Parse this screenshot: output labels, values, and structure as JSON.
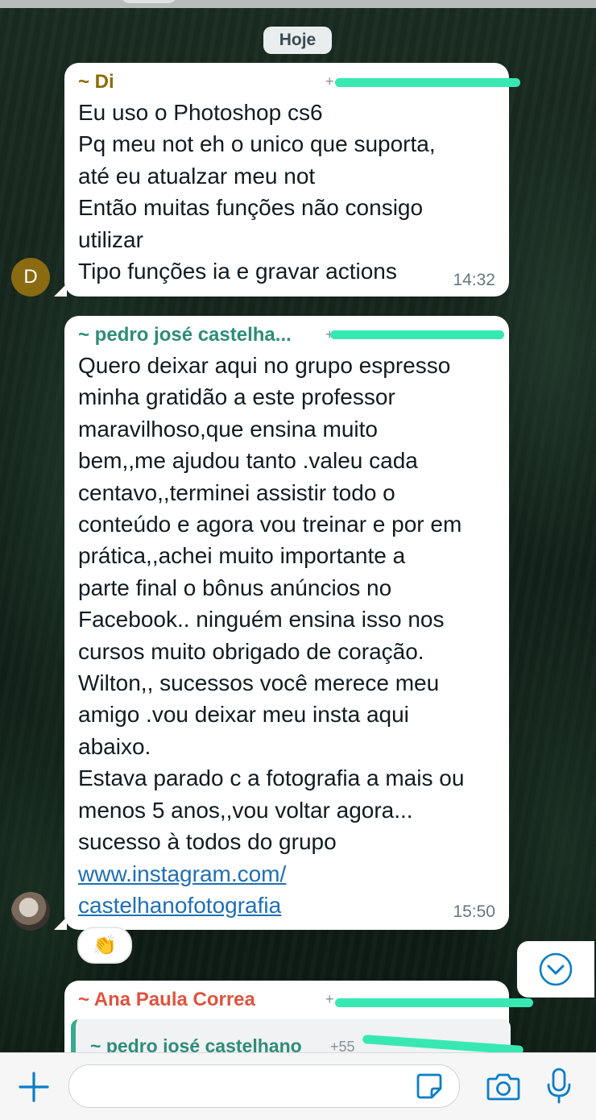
{
  "date_divider": "Hoje",
  "messages": [
    {
      "sender": "~ Di",
      "sender_color": "#8f6a0a",
      "phone": "+",
      "avatar_initial": "D",
      "lines": [
        "Eu uso o Photoshop cs6",
        "Pq meu not eh o unico que suporta,",
        "até eu atualzar meu not",
        "Então muitas funções não consigo",
        "utilizar",
        "Tipo funções ia e gravar actions"
      ],
      "time": "14:32"
    },
    {
      "sender": "~ pedro josé castelha...",
      "sender_color": "#2e8c7a",
      "phone": "+",
      "lines": [
        "Quero deixar aqui no grupo espresso",
        "minha gratidão a este professor",
        "maravilhoso,que ensina muito",
        "bem,,me ajudou tanto .valeu cada",
        "centavo,,terminei assistir todo o",
        "conteúdo e agora vou treinar e por em",
        "prática,,achei muito importante a",
        "parte final o bônus anúncios no",
        "Facebook.. ninguém ensina isso nos",
        "cursos muito obrigado de coração.",
        "Wilton,, sucessos você merece meu",
        "amigo .vou deixar meu insta aqui",
        "abaixo.",
        "Estava parado c a fotografia a mais ou",
        "menos 5 anos,,vou voltar agora...",
        "sucesso à todos do grupo"
      ],
      "link_lines": [
        "www.instagram.com/",
        "castelhanofotografia"
      ],
      "time": "15:50",
      "reaction": "👏"
    },
    {
      "sender": "~ Ana Paula Correa",
      "sender_color": "#e0533f",
      "phone": "+",
      "quoted_sender": "~ pedro josé castelhano",
      "quoted_phone": "+55"
    }
  ],
  "icons": {
    "scroll_down": "chevron-down-circle-icon",
    "attach": "plus-icon",
    "sticker": "sticker-icon",
    "camera": "camera-icon",
    "mic": "microphone-icon"
  },
  "colors": {
    "accent": "#0b7ec7",
    "redaction": "#38e8b3"
  },
  "composer": {
    "value": ""
  }
}
